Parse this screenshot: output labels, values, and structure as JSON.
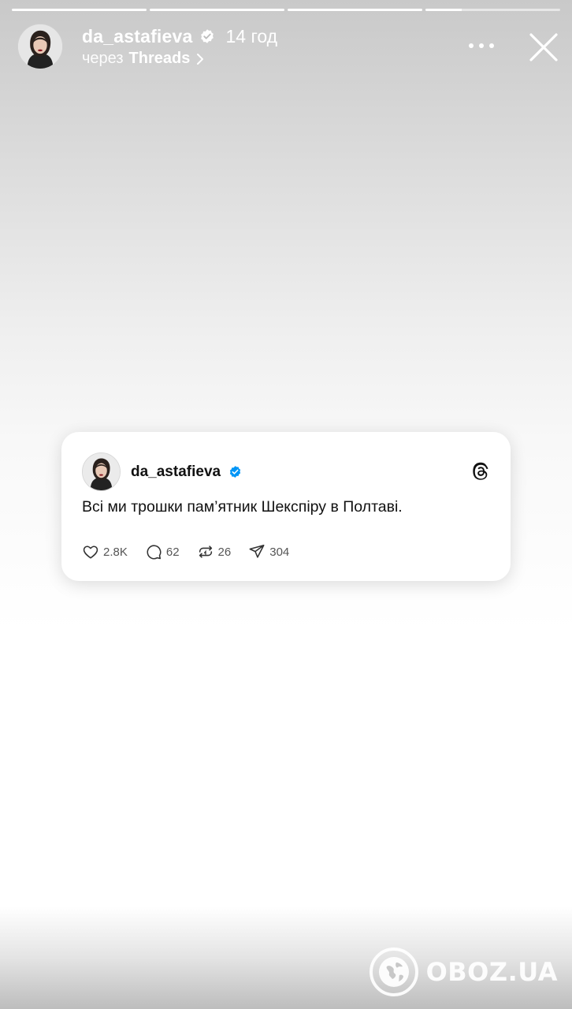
{
  "story": {
    "progress": [
      1.0,
      1.0,
      1.0,
      0.27
    ],
    "username": "da_astafieva",
    "time": "14 год",
    "via_label": "через",
    "via_app": "Threads"
  },
  "post": {
    "username": "da_astafieva",
    "text": "Всі ми трошки пам’ятник Шекспіру в Полтаві.",
    "likes": "2.8K",
    "replies": "62",
    "reposts": "26",
    "shares": "304"
  },
  "watermark": {
    "text": "OBOZ.UA"
  },
  "colors": {
    "verified_blue": "#0095f6",
    "text_dark": "#111111",
    "stat_gray": "#555555"
  },
  "icons": [
    "verified-badge-icon",
    "chevron-right-icon",
    "more-icon",
    "close-icon",
    "threads-logo-icon",
    "heart-icon",
    "comment-icon",
    "repost-icon",
    "share-icon",
    "globe-logo-icon"
  ]
}
